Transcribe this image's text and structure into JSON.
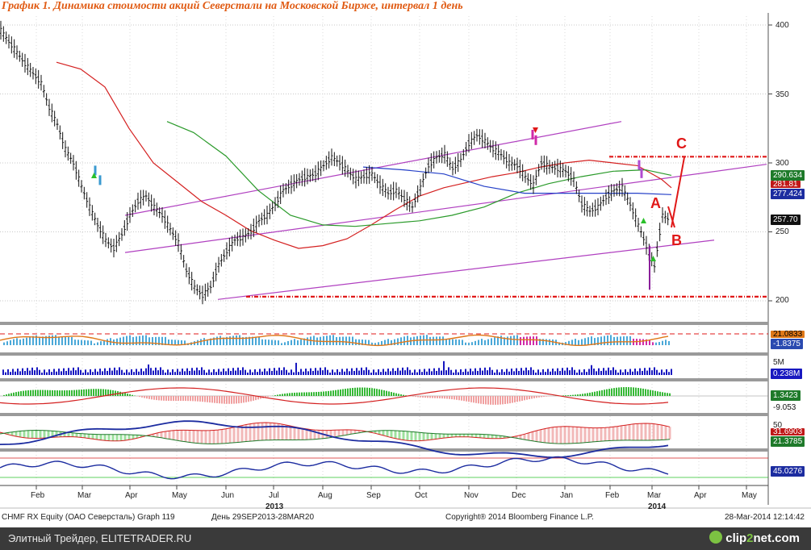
{
  "title": "График 1. Динамика стоимости акций Северстали на Московской Бирже, интервал 1 день",
  "footer": {
    "left": "Элитный Трейдер, ELITETRADER.RU",
    "right_prefix": "clip",
    "right_accent": "2",
    "right_suffix": "net.com"
  },
  "info": {
    "ticker": "CHMF RX Equity (ОАО Северсталь) Graph 119",
    "period": "День 29SEP2013-28MAR20",
    "copyright": "Copyright® 2014 Bloomberg Finance L.P.",
    "timestamp": "28-Mar-2014 12:14:42"
  },
  "colors": {
    "price": "#111111",
    "up": "#1a1a1a",
    "channel": "#b040c0",
    "ma_red": "#d42020",
    "ma_green": "#2a9a2a",
    "ma_blue": "#2540c8",
    "dashed": "#e01818",
    "volume": "#1818c0"
  },
  "badges": [
    {
      "text": "290.634",
      "bg": "#1e7a2a",
      "fg": "#ffffff"
    },
    {
      "text": "281.81",
      "bg": "#c01818",
      "fg": "#ffffff"
    },
    {
      "text": "277.424",
      "bg": "#1c2ca0",
      "fg": "#ffffff"
    },
    {
      "text": "257.70",
      "bg": "#111111",
      "fg": "#ffffff"
    },
    {
      "text": "21.0833",
      "bg": "#e07818",
      "fg": "#000000"
    },
    {
      "text": "-1.8375",
      "bg": "#2a4ab0",
      "fg": "#ffffff"
    },
    {
      "text": "5M",
      "bg": "#ffffff",
      "fg": "#222222"
    },
    {
      "text": "0.238M",
      "bg": "#1818c0",
      "fg": "#ffffff"
    },
    {
      "text": "1.3423",
      "bg": "#1e7a2a",
      "fg": "#ffffff"
    },
    {
      "text": "-9.053",
      "bg": "#ffffff",
      "fg": "#111111"
    },
    {
      "text": "50",
      "bg": "#ffffff",
      "fg": "#222222"
    },
    {
      "text": "31.6903",
      "bg": "#c01818",
      "fg": "#ffffff"
    },
    {
      "text": "21.3785",
      "bg": "#1e7a2a",
      "fg": "#ffffff"
    },
    {
      "text": "45.0276",
      "bg": "#1c2ca0",
      "fg": "#ffffff"
    }
  ],
  "annotations": {
    "a": "A",
    "b": "B",
    "c": "C"
  },
  "chart_data": {
    "type": "line",
    "y_ticks": [
      200,
      250,
      300,
      350,
      400
    ],
    "ylim": [
      185,
      408
    ],
    "month_labels": [
      "Feb",
      "Mar",
      "Apr",
      "May",
      "Jun",
      "Jul",
      "Aug",
      "Sep",
      "Oct",
      "Nov",
      "Dec",
      "Jan",
      "Feb",
      "Mar",
      "Apr",
      "May"
    ],
    "year_labels": [
      "2013",
      "2014"
    ],
    "last_price": 257.7,
    "series": [
      {
        "name": "price",
        "x": [
          0,
          10,
          20,
          30,
          40,
          50,
          60,
          70,
          80,
          90,
          100,
          110,
          120,
          130,
          140,
          150,
          160,
          170,
          180,
          190,
          200,
          210,
          220,
          230,
          240,
          250,
          260,
          270,
          280,
          290,
          300,
          310,
          320,
          330,
          340,
          350,
          360,
          370,
          380,
          390,
          400,
          410,
          420,
          430,
          440,
          450,
          460,
          470,
          480,
          490,
          500,
          510,
          520,
          530,
          540,
          550,
          560,
          570,
          580,
          590,
          600,
          610,
          620,
          630,
          640,
          650,
          660,
          670,
          680,
          690,
          700,
          710,
          720,
          730,
          740,
          750,
          760,
          770,
          780,
          790,
          800,
          810,
          820,
          830
        ],
        "y": [
          396,
          388,
          380,
          372,
          365,
          358,
          340,
          328,
          310,
          300,
          283,
          268,
          255,
          244,
          238,
          248,
          262,
          272,
          276,
          268,
          262,
          252,
          242,
          222,
          210,
          204,
          210,
          226,
          236,
          244,
          246,
          250,
          258,
          262,
          270,
          280,
          284,
          288,
          290,
          292,
          298,
          304,
          300,
          294,
          288,
          290,
          292,
          284,
          278,
          280,
          274,
          268,
          282,
          298,
          304,
          306,
          296,
          302,
          314,
          320,
          316,
          310,
          306,
          300,
          298,
          290,
          284,
          300,
          297,
          296,
          294,
          288,
          270,
          265,
          268,
          275,
          280,
          282,
          270,
          255,
          240,
          225,
          262,
          258
        ]
      },
      {
        "name": "ma_red",
        "x": [
          70,
          100,
          130,
          160,
          190,
          220,
          250,
          280,
          310,
          340,
          370,
          400,
          430,
          460,
          490,
          520,
          550,
          580,
          610,
          640,
          670,
          700,
          730,
          760,
          790,
          820,
          832
        ],
        "y": [
          373,
          368,
          355,
          325,
          300,
          286,
          272,
          262,
          251,
          244,
          238,
          240,
          245,
          255,
          266,
          276,
          282,
          286,
          290,
          293,
          297,
          300,
          302,
          300,
          298,
          288,
          282
        ]
      },
      {
        "name": "ma_green",
        "x": [
          207,
          240,
          280,
          320,
          360,
          400,
          440,
          480,
          520,
          560,
          600,
          640,
          680,
          720,
          760,
          800,
          832
        ],
        "y": [
          330,
          322,
          305,
          280,
          262,
          255,
          254,
          256,
          258,
          262,
          268,
          278,
          285,
          290,
          294,
          295,
          291
        ]
      },
      {
        "name": "ma_blue",
        "x": [
          450,
          500,
          550,
          600,
          650,
          700,
          750,
          790,
          832
        ],
        "y": [
          297,
          295,
          292,
          283,
          278,
          278,
          278,
          278,
          277
        ]
      }
    ],
    "channel_upper": {
      "x": [
        155,
        770
      ],
      "y": [
        262,
        330
      ]
    },
    "channel_mid": {
      "x": [
        155,
        950
      ],
      "y": [
        235,
        299
      ]
    },
    "channel_lower": {
      "x": [
        270,
        885
      ],
      "y": [
        201,
        244
      ]
    },
    "resistance": {
      "x": [
        755,
        952
      ],
      "y": 304.5
    },
    "support": {
      "x": [
        305,
        952
      ],
      "y": 203
    }
  }
}
